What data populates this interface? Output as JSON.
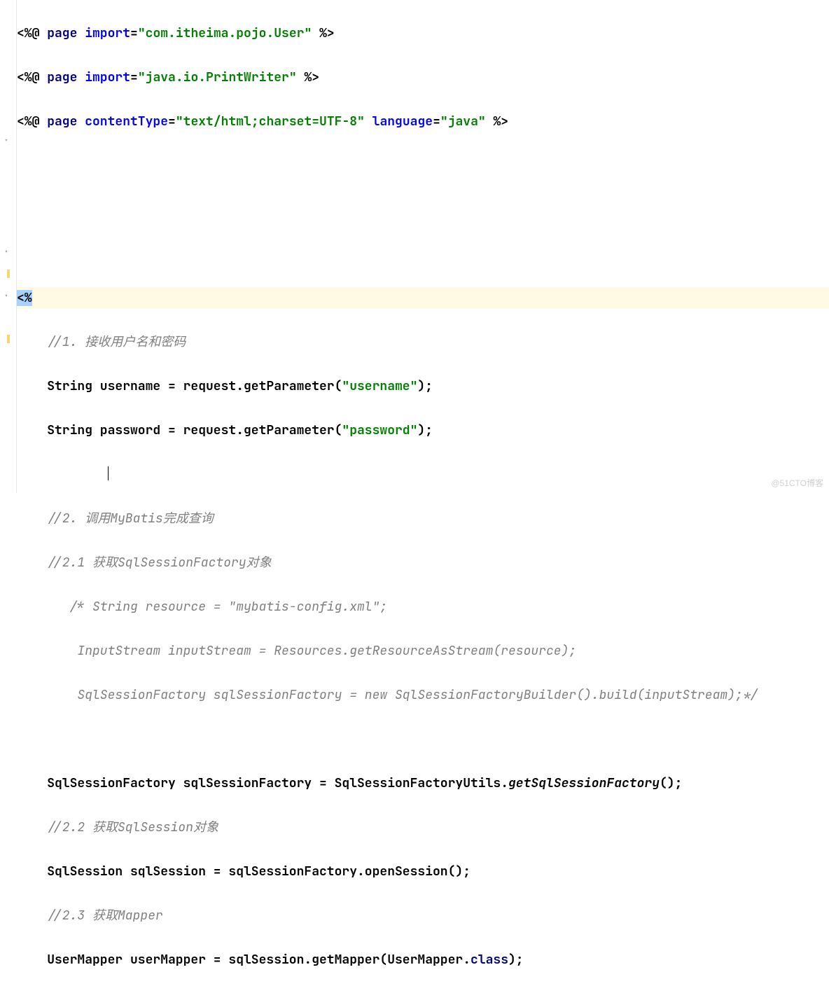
{
  "lines": {
    "l1_pre": "<%@ ",
    "l1_page": "page ",
    "l1_import": "import",
    "l1_eq": "=",
    "l1_q1": "\"",
    "l1_val": "com.itheima.pojo.User",
    "l1_q2": "\"",
    "l1_post": " %>",
    "l2_pre": "<%@ ",
    "l2_page": "page ",
    "l2_import": "import",
    "l2_eq": "=",
    "l2_q1": "\"",
    "l2_val": "java.io.PrintWriter",
    "l2_q2": "\"",
    "l2_post": " %>",
    "l3_pre": "<%@ ",
    "l3_page": "page ",
    "l3_ct": "contentType",
    "l3_eq1": "=",
    "l3_q1": "\"",
    "l3_val1": "text/html;charset=UTF-8",
    "l3_q2": "\"",
    "l3_lang": " language",
    "l3_eq2": "=",
    "l3_q3": "\"",
    "l3_val2": "java",
    "l3_q4": "\"",
    "l3_post": " %>",
    "l7": "<%",
    "l8_indent": "    ",
    "l8": "//1. 接收用户名和密码",
    "l9_indent": "    ",
    "l9_a": "String username = request.getParameter(",
    "l9_s": "\"username\"",
    "l9_b": ");",
    "l10_indent": "    ",
    "l10_a": "String password = request.getParameter(",
    "l10_s": "\"password\"",
    "l10_b": ");",
    "l11_indent": "            ",
    "l12_indent": "    ",
    "l12": "//2. 调用MyBatis完成查询",
    "l13_indent": "    ",
    "l13": "//2.1 获取SqlSessionFactory对象",
    "l14_indent": "       ",
    "l14": "/* String resource = \"mybatis-config.xml\";",
    "l15_indent": "        ",
    "l15": "InputStream inputStream = Resources.getResourceAsStream(resource);",
    "l16_indent": "        ",
    "l16": "SqlSessionFactory sqlSessionFactory = new SqlSessionFactoryBuilder().build(inputStream);*/",
    "l18_indent": "    ",
    "l18_a": "SqlSessionFactory sqlSessionFactory = SqlSessionFactoryUtils.",
    "l18_m": "getSqlSessionFactory",
    "l18_b": "();",
    "l19_indent": "    ",
    "l19": "//2.2 获取SqlSession对象",
    "l20_indent": "    ",
    "l20": "SqlSession sqlSession = sqlSessionFactory.openSession();",
    "l21_indent": "    ",
    "l21": "//2.3 获取Mapper",
    "l22_indent": "    ",
    "l22_a": "UserMapper userMapper = sqlSession.getMapper(UserMapper.",
    "l22_kw": "class",
    "l22_b": ");"
  },
  "watermark": "@51CTO博客"
}
